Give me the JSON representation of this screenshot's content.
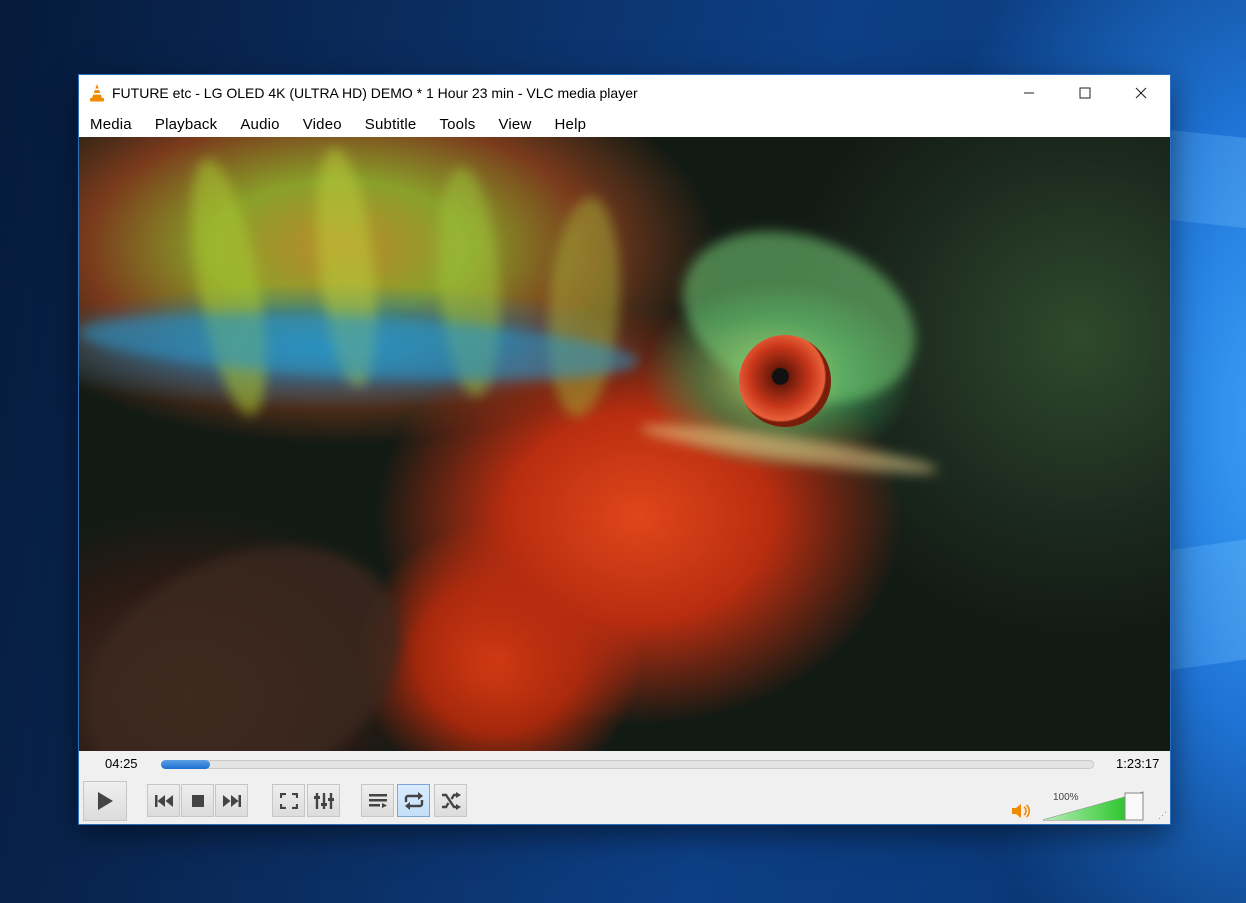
{
  "window": {
    "title": "FUTURE etc - LG OLED 4K (ULTRA HD) DEMO * 1 Hour 23 min - VLC media player",
    "app_icon": "vlc-cone-icon",
    "buttons": [
      "minimize-icon",
      "maximize-icon",
      "close-icon"
    ]
  },
  "menu": {
    "items": [
      "Media",
      "Playback",
      "Audio",
      "Video",
      "Subtitle",
      "Tools",
      "View",
      "Help"
    ]
  },
  "playback": {
    "elapsed": "04:25",
    "total": "1:23:17",
    "progress_fraction": 0.053
  },
  "controls": {
    "buttons": [
      {
        "name": "play-button",
        "icon": "play-icon"
      },
      {
        "name": "previous-button",
        "icon": "skip-previous-icon"
      },
      {
        "name": "stop-button",
        "icon": "stop-icon"
      },
      {
        "name": "next-button",
        "icon": "skip-next-icon"
      },
      {
        "name": "fullscreen-button",
        "icon": "fullscreen-icon"
      },
      {
        "name": "extended-settings-button",
        "icon": "equalizer-icon"
      },
      {
        "name": "playlist-button",
        "icon": "playlist-icon"
      },
      {
        "name": "loop-button",
        "icon": "loop-icon",
        "active": true
      },
      {
        "name": "shuffle-button",
        "icon": "shuffle-icon"
      }
    ]
  },
  "volume": {
    "label": "100%",
    "level_fraction": 1.0,
    "icon": "speaker-icon",
    "fill_color": "#2fc62f"
  },
  "colors": {
    "accent": "#1c6fd1",
    "vlc_orange": "#f08a00"
  }
}
